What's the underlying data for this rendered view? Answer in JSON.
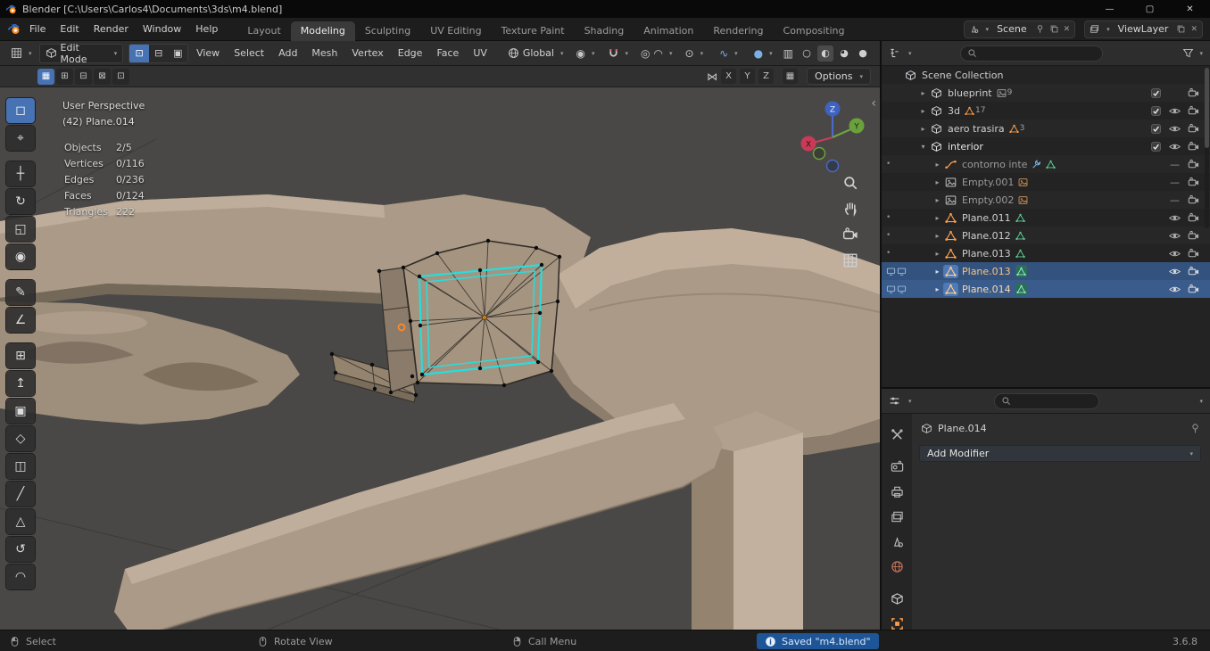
{
  "colors": {
    "accent_blue": "#4772b3",
    "selection_row_blue": "#33527e",
    "selection_cyan": "#25dede",
    "viewport_bg": "#4a4846",
    "body_tan": "#ab9a87",
    "body_tan_light": "#c4b3a0",
    "body_tan_dark": "#8d7d6c",
    "body_tan_deep": "#746858",
    "mesh_orange": "#ff9e4a",
    "mesh_data_green": "#5ecf9a",
    "origin_orange": "#ff8a28",
    "saved_badge_blue": "#1e5596"
  },
  "titlebar": {
    "title": "Blender [C:\\Users\\Carlos4\\Documents\\3ds\\m4.blend]"
  },
  "menubar": {
    "menus": [
      "File",
      "Edit",
      "Render",
      "Window",
      "Help"
    ],
    "workspaces": [
      "Layout",
      "Modeling",
      "Sculpting",
      "UV Editing",
      "Texture Paint",
      "Shading",
      "Animation",
      "Rendering",
      "Compositing"
    ],
    "scene_label": "Scene",
    "viewlayer_label": "ViewLayer"
  },
  "tool_header": {
    "mode_label": "Edit Mode",
    "menus": [
      "View",
      "Select",
      "Add",
      "Mesh",
      "Vertex",
      "Edge",
      "Face",
      "UV"
    ],
    "orientation_label": "Global"
  },
  "tool_settings": {
    "axis_x": "X",
    "axis_y": "Y",
    "axis_z": "Z",
    "options_label": "Options"
  },
  "viewport": {
    "overlay": {
      "view_label": "User Perspective",
      "object_label": "(42) Plane.014",
      "stats": [
        {
          "label": "Objects",
          "value": "2/5"
        },
        {
          "label": "Vertices",
          "value": "0/116"
        },
        {
          "label": "Edges",
          "value": "0/236"
        },
        {
          "label": "Faces",
          "value": "0/124"
        },
        {
          "label": "Triangles",
          "value": "222"
        }
      ]
    },
    "gizmo": {
      "x": "X",
      "y": "Y",
      "z": "Z"
    }
  },
  "outliner": {
    "rows": [
      {
        "label": "Scene Collection"
      },
      {
        "label": "blueprint",
        "badge": "9"
      },
      {
        "label": "3d",
        "badge": "17"
      },
      {
        "label": "aero trasira",
        "badge": "3"
      },
      {
        "label": "interior"
      },
      {
        "label": "contorno inte"
      },
      {
        "label": "Empty.001"
      },
      {
        "label": "Empty.002"
      },
      {
        "label": "Plane.011"
      },
      {
        "label": "Plane.012"
      },
      {
        "label": "Plane.013"
      },
      {
        "label": "Plane.013"
      },
      {
        "label": "Plane.014"
      }
    ]
  },
  "properties": {
    "breadcrumb": "Plane.014",
    "add_modifier_label": "Add Modifier"
  },
  "statusbar": {
    "select_label": "Select",
    "rotate_label": "Rotate View",
    "menu_label": "Call Menu",
    "saved_label": "Saved \"m4.blend\"",
    "version": "3.6.8"
  },
  "icons": {
    "dropdown": "▾",
    "disclosure": "▸",
    "disclosure_open": "▾",
    "dot": "•",
    "minimize": "—",
    "maximize": "▢",
    "close": "✕",
    "collapse_arrow": "‹",
    "hidden_dash": "—",
    "mode_vertex": "⊡",
    "mode_edge": "⊟",
    "mode_face": "▣",
    "sel_new": "▦",
    "sel_extend": "⊞",
    "sel_subtract": "⊟",
    "sel_invert": "⊠",
    "sel_intersect": "⊡",
    "mirror": "⋈",
    "snap_grid_btn": "▦",
    "pivot": "◉",
    "prop_edit": "◎",
    "falloff": "◠",
    "overlay_a": "⊙",
    "overlay_b": "∿",
    "xray": "▥",
    "shade_wire": "○",
    "shade_solid": "◐",
    "shade_material": "◕",
    "shade_render": "●",
    "tool_select_box": "◻",
    "tool_cursor": "⌖",
    "tool_move": "┼",
    "tool_rotate": "↻",
    "tool_scale": "◱",
    "tool_transform": "◉",
    "tool_annotate": "✎",
    "tool_measure": "∠",
    "tool_add_cube": "⊞",
    "tool_extrude": "↥",
    "tool_inset": "▣",
    "tool_bevel": "◇",
    "tool_loop_cut": "◫",
    "tool_knife": "╱",
    "tool_poly_build": "△",
    "tool_spin": "↺",
    "tool_smooth": "◠"
  }
}
